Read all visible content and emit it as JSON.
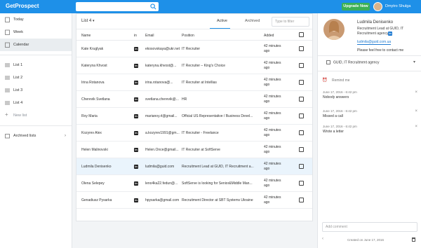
{
  "topbar": {
    "logo": "GetProspect",
    "upgrade": "Upgrade Now",
    "user": "Dmytro Shulga"
  },
  "sidebar": {
    "items": [
      {
        "label": "Today",
        "icon": "calendar-icon"
      },
      {
        "label": "Week",
        "icon": "calendar-icon"
      },
      {
        "label": "Calendar",
        "icon": "calendar-icon"
      }
    ],
    "lists": [
      "List 1",
      "List 2",
      "List 3",
      "List 4"
    ],
    "new_list": "New list",
    "archived": "Archived lists"
  },
  "main": {
    "list_selector": "List 4",
    "tab_active": "Active",
    "tab_archived": "Archived",
    "filter_placeholder": "Type to filter",
    "columns": {
      "name": "Name",
      "in": "in",
      "email": "Email",
      "position": "Position",
      "added": "Added"
    },
    "rows": [
      {
        "name": "Kate Kruglyak",
        "email": "ekosovskaya@ukr.net",
        "position": "IT Recruiter",
        "added": "42 minutes ago"
      },
      {
        "name": "Kateryna Khvost",
        "email": "kateryna.khvost@...",
        "position": "IT Recruiter – King's Choice",
        "added": "42 minutes ago"
      },
      {
        "name": "Irina Rotanova",
        "email": "irina.rotanova@...",
        "position": "IT Recruiter at Intellias",
        "added": "42 minutes ago"
      },
      {
        "name": "Cherevik Svetlana",
        "email": "svetlana.cherevik@...",
        "position": "HR",
        "added": "42 minutes ago"
      },
      {
        "name": "Roy Maria",
        "email": "marianoy.rl@gmail...",
        "position": "Official US Representative / Business Devel...",
        "added": "42 minutes ago"
      },
      {
        "name": "Kozyrev Alex",
        "email": "a.kozyrev1991@gm...",
        "position": "IT Recruiter - Freelance",
        "added": "42 minutes ago"
      },
      {
        "name": "Helen Malinovski",
        "email": "Helen.Once@gmail...",
        "position": "IT Recruiter at SoftServe",
        "added": "42 minutes ago"
      },
      {
        "name": "Ludmila Denisenko",
        "email": "ludmila@guid.com",
        "position": "Recruitment Lead at GUID, IT Recruitment a...",
        "added": "42 minutes ago"
      },
      {
        "name": "Olena Selepey",
        "email": "lenо4ka22.fedun@...",
        "position": "SoftServe is looking for Senior&Middle Man...",
        "added": "42 minutes ago"
      },
      {
        "name": "Genadiusz Pysarka",
        "email": "hpysarka@gmail.com",
        "position": "Recruitment Director at SBT Systems Ukraine",
        "added": "42 minutes ago"
      }
    ]
  },
  "profile": {
    "name": "Ludmila Denisenko",
    "title": "Recruitment Lead at GUID, IT Recruitment agency",
    "email": "ludmila@guid.com.ua",
    "contact": "Please feel free to contact me",
    "company": "GUID, IT Recruitment agency",
    "remind": "Remind me",
    "notes": [
      {
        "date": "June 17, 2016 - 6:42 pm",
        "text": "Nobody answers"
      },
      {
        "date": "June 17, 2016 - 6:42 pm",
        "text": "Missed a call"
      },
      {
        "date": "June 17, 2016 - 6:42 pm",
        "text": "Wrote a letter"
      }
    ],
    "add_comment": "Add comment",
    "created": "Created on June 17, 2016"
  }
}
